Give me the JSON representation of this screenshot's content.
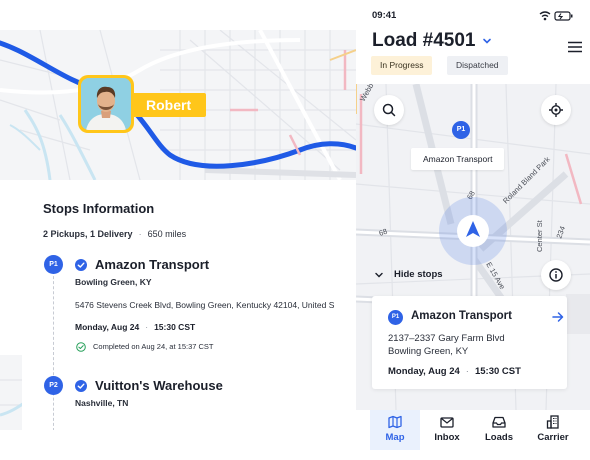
{
  "driver": {
    "name": "Robert"
  },
  "stops_panel": {
    "title": "Stops Information",
    "summary_counts": "2 Pickups, 1 Delivery",
    "summary_distance": "650 miles",
    "stops": [
      {
        "badge": "P1",
        "name": "Amazon Transport",
        "city": "Bowling Green, KY",
        "address": "5476 Stevens Creek Blvd, Bowling Green, Kentucky 42104, United S",
        "date": "Monday, Aug 24",
        "time": "15:30 CST",
        "completed": "Completed on Aug 24, at 15:37 CST"
      },
      {
        "badge": "P2",
        "name": "Vuitton's Warehouse",
        "city": "Nashville, TN"
      }
    ]
  },
  "phone": {
    "status_time": "09:41",
    "load_title": "Load #4501",
    "tags": [
      "In Progress",
      "Dispatched"
    ],
    "map": {
      "place_badge": "P1",
      "place_label": "Amazon Transport",
      "street_labels": [
        "Webb",
        "68",
        "68",
        "Roland Bland Park",
        "Center St",
        "234",
        "E 15 Ave"
      ]
    },
    "hide_stops_label": "Hide stops",
    "current_stop": {
      "badge": "P1",
      "name": "Amazon Transport",
      "address_line1": "2137–2337 Gary Farm Blvd",
      "address_line2": "Bowling Green, KY",
      "date": "Monday, Aug 24",
      "time": "15:30 CST"
    },
    "tabs": [
      {
        "label": "Map",
        "icon": "map-icon",
        "active": true
      },
      {
        "label": "Inbox",
        "icon": "mail-icon",
        "active": false
      },
      {
        "label": "Loads",
        "icon": "inbox-tray-icon",
        "active": false
      },
      {
        "label": "Carrier",
        "icon": "building-icon",
        "active": false
      }
    ]
  },
  "colors": {
    "accent_blue": "#2f63e6",
    "route_blue": "#1f5ae6",
    "driver_yellow": "#ffc61a"
  }
}
